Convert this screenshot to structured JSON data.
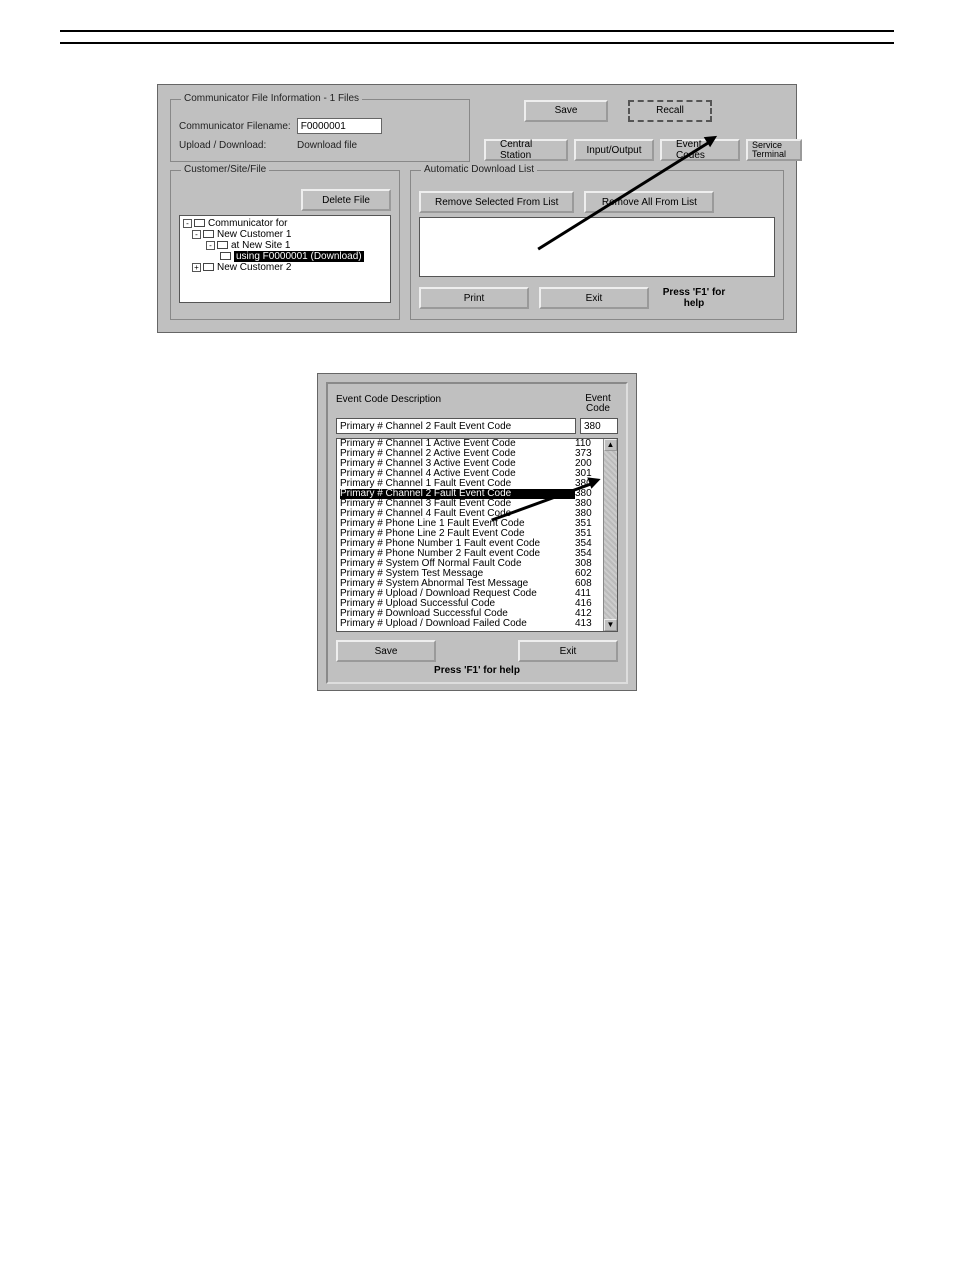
{
  "app1": {
    "groupTitle": "Communicator File Information - 1 Files",
    "filenameLabel": "Communicator Filename:",
    "filename": "F0000001",
    "uploadLabel": "Upload / Download:",
    "uploadValue": "Download file",
    "saveBtn": "Save",
    "recallBtn": "Recall",
    "tabs": {
      "central": "Central Station",
      "io": "Input/Output",
      "codes": "Event Codes",
      "service": "Service Terminal"
    },
    "customerGroup": {
      "legend": "Customer/Site/File",
      "deleteBtn": "Delete File",
      "tree": {
        "root": "Communicator for",
        "c1": "New Customer 1",
        "s1": "at New Site 1",
        "use": "using F0000001 (Download)",
        "c2": "New Customer 2"
      }
    },
    "dlGroup": {
      "legend": "Automatic Download List",
      "removeSel": "Remove Selected From List",
      "removeAll": "Remove All From List"
    },
    "bottom": {
      "print": "Print",
      "exit": "Exit",
      "help": "Press 'F1' for help"
    }
  },
  "app2": {
    "descHeader": "Event Code Description",
    "codeHeader": "Event Code",
    "currentDesc": "Primary # Channel 2 Fault Event Code",
    "currentCode": "380",
    "rows": [
      {
        "d": "Primary # Channel 1 Active Event Code",
        "c": "110"
      },
      {
        "d": "Primary # Channel 2 Active Event Code",
        "c": "373"
      },
      {
        "d": "Primary # Channel 3 Active Event Code",
        "c": "200"
      },
      {
        "d": "Primary # Channel 4 Active Event Code",
        "c": "301"
      },
      {
        "d": "Primary # Channel 1 Fault Event Code",
        "c": "380"
      },
      {
        "d": "Primary # Channel 2 Fault Event Code",
        "c": "380",
        "sel": true
      },
      {
        "d": "Primary # Channel 3 Fault Event Code",
        "c": "380"
      },
      {
        "d": "Primary # Channel 4 Fault Event Code",
        "c": "380"
      },
      {
        "d": "Primary # Phone Line 1 Fault Event Code",
        "c": "351"
      },
      {
        "d": "Primary # Phone Line 2 Fault Event Code",
        "c": "351"
      },
      {
        "d": "Primary # Phone Number 1 Fault event Code",
        "c": "354"
      },
      {
        "d": "Primary # Phone Number 2 Fault event Code",
        "c": "354"
      },
      {
        "d": "Primary # System Off Normal Fault Code",
        "c": "308"
      },
      {
        "d": "Primary # System Test Message",
        "c": "602"
      },
      {
        "d": "Primary # System Abnormal  Test Message",
        "c": "608"
      },
      {
        "d": "Primary # Upload / Download Request Code",
        "c": "411"
      },
      {
        "d": "Primary # Upload Successful Code",
        "c": "416"
      },
      {
        "d": "Primary # Download Successful Code",
        "c": "412"
      },
      {
        "d": "Primary # Upload / Download Failed Code",
        "c": "413"
      }
    ],
    "saveBtn": "Save",
    "exitBtn": "Exit",
    "help": "Press 'F1' for help"
  }
}
